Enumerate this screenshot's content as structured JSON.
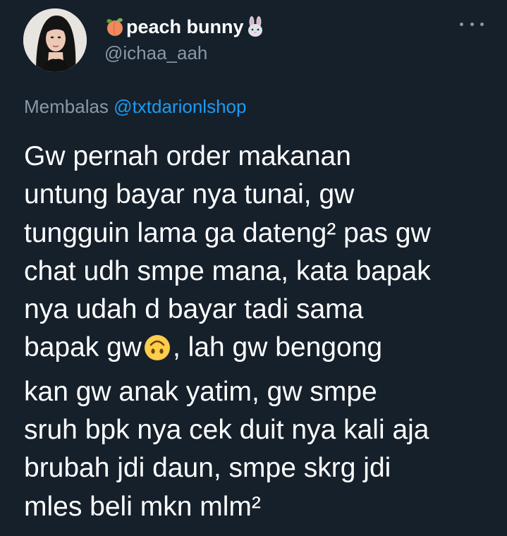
{
  "tweet": {
    "author": {
      "display_name": "peach bunny",
      "name_prefix_emoji": "peach-emoji",
      "name_suffix_emoji": "rabbit-emoji",
      "handle": "@ichaa_aah"
    },
    "more_icon": "more-horizontal-icon",
    "reply_context": {
      "label": "Membalas",
      "mention": "@txtdarionlshop"
    },
    "text_lines": [
      "Gw pernah order makanan",
      "untung bayar nya tunai, gw",
      "tungguin lama ga dateng² pas gw",
      "chat udh smpe mana, kata bapak",
      "nya udah d bayar tadi sama",
      "bapak gw",
      ", lah gw bengong",
      "kan gw anak yatim, gw smpe",
      "sruh bpk nya cek duit nya kali aja",
      "brubah jdi daun, smpe skrg jdi",
      "mles beli mkn mlm²"
    ],
    "inline_emoji": "upside-down-face-emoji"
  },
  "colors": {
    "background": "#15202b",
    "primary_text": "#ffffff",
    "secondary_text": "#8b98a5",
    "link": "#1d9bf0"
  }
}
